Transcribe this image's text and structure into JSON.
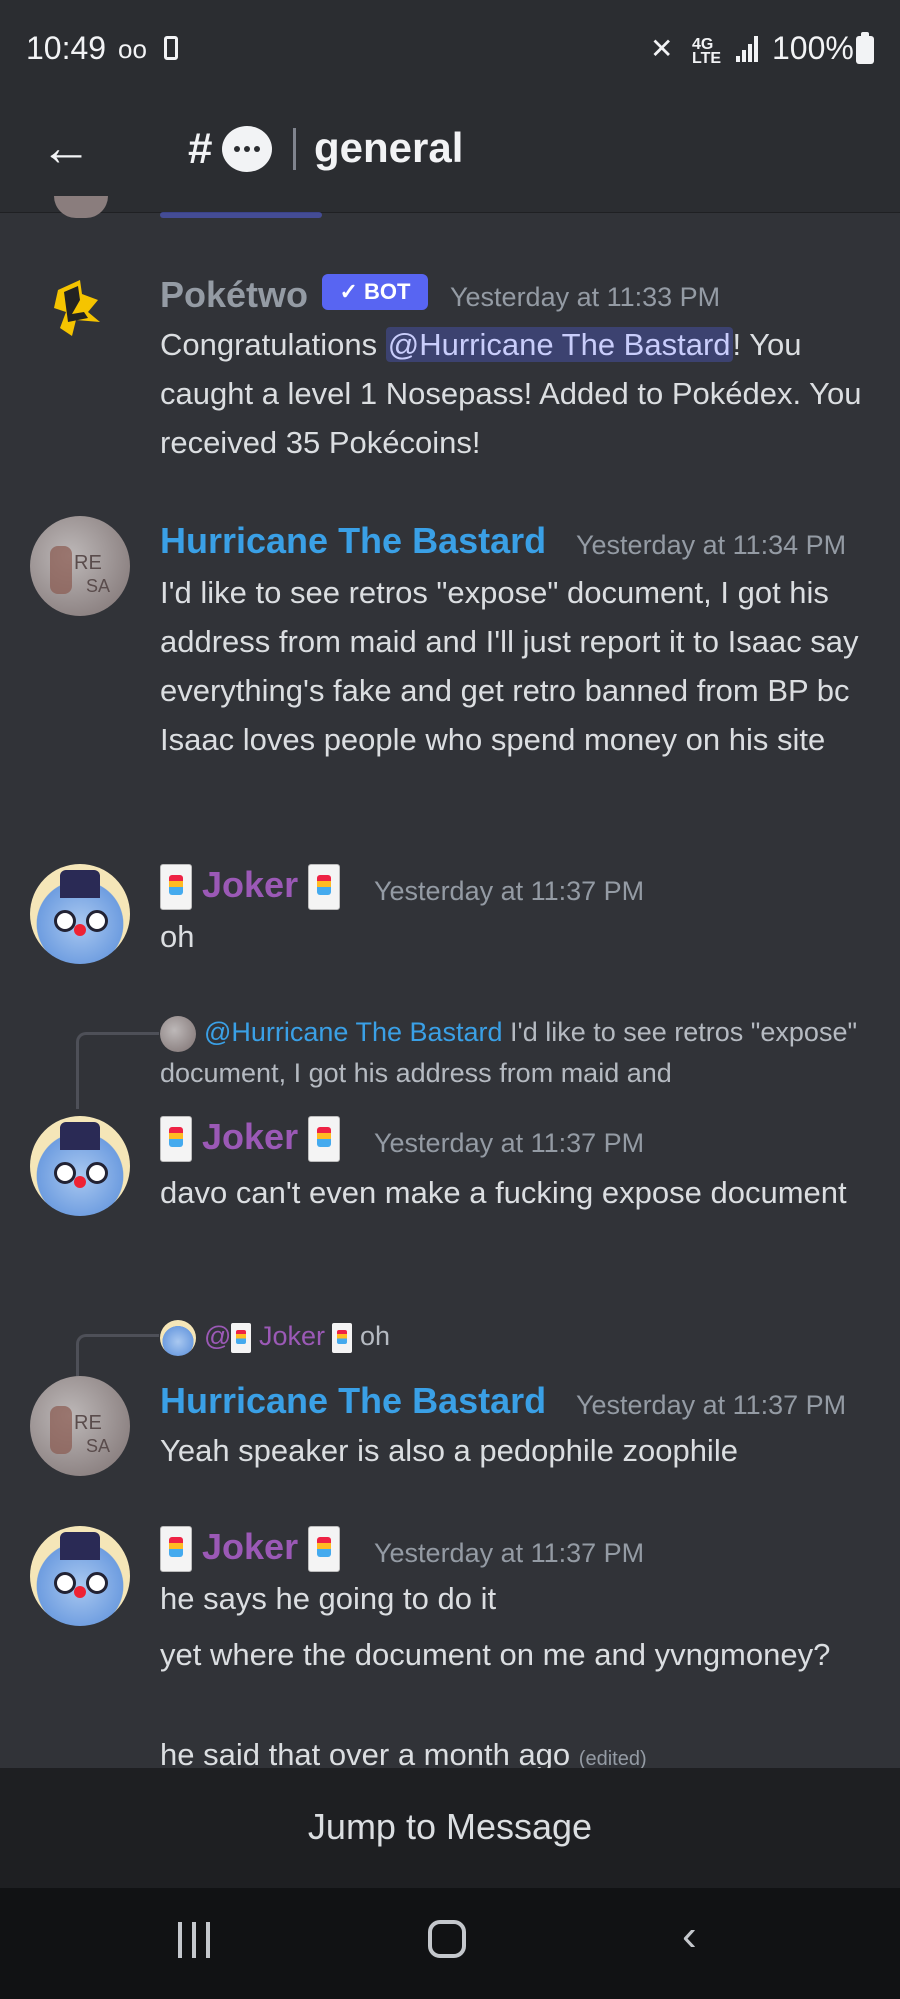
{
  "status_bar": {
    "time": "10:49",
    "voicemail_icon": "oo",
    "battery_percent": "100%",
    "network": "4G LTE"
  },
  "header": {
    "hash": "#",
    "channel": "general",
    "back_icon": "arrow-left-icon",
    "thread_icon": "chat-bubble-icon"
  },
  "messages": [
    {
      "author": "Pokétwo",
      "badge": "✓ BOT",
      "timestamp": "Yesterday at 11:33 PM",
      "text_before": "Congratulations ",
      "mention": "@Hurricane The Bastard",
      "text_after": "! You caught a level 1 Nosepass! Added to Pokédex. You received 35 Pokécoins!"
    },
    {
      "author": "Hurricane The Bastard",
      "timestamp": "Yesterday at 11:34 PM",
      "text": "I'd like to see retros \"expose\" document, I got his address from maid and I'll just report it to Isaac say everything's fake and get retro banned from BP bc Isaac loves people who spend money on his site"
    },
    {
      "author": "Joker",
      "timestamp": "Yesterday at 11:37 PM",
      "text": "oh"
    },
    {
      "reply_author": "@Hurricane The Bastard",
      "reply_text": " I'd like to see retros \"expose\" document, I got his address from maid and",
      "author": "Joker",
      "timestamp": "Yesterday at 11:37 PM",
      "text": "davo can't even make a fucking expose document"
    },
    {
      "reply_author_prefix": "@",
      "reply_author": "Joker",
      "reply_text": "oh",
      "author": "Hurricane The Bastard",
      "timestamp": "Yesterday at 11:37 PM",
      "text": "Yeah speaker is also a pedophile zoophile"
    },
    {
      "author": "Joker",
      "timestamp": "Yesterday at 11:37 PM",
      "text": "he says he going to do it",
      "text2": "yet where the document on me and yvngmoney?",
      "text3": "he said that over a month ago",
      "edited": "(edited)"
    }
  ],
  "jump_bar": {
    "label": "Jump to Message"
  },
  "nav": {
    "recents_icon": "recents-icon",
    "home_icon": "home-icon",
    "back_icon": "back-chevron-icon"
  }
}
